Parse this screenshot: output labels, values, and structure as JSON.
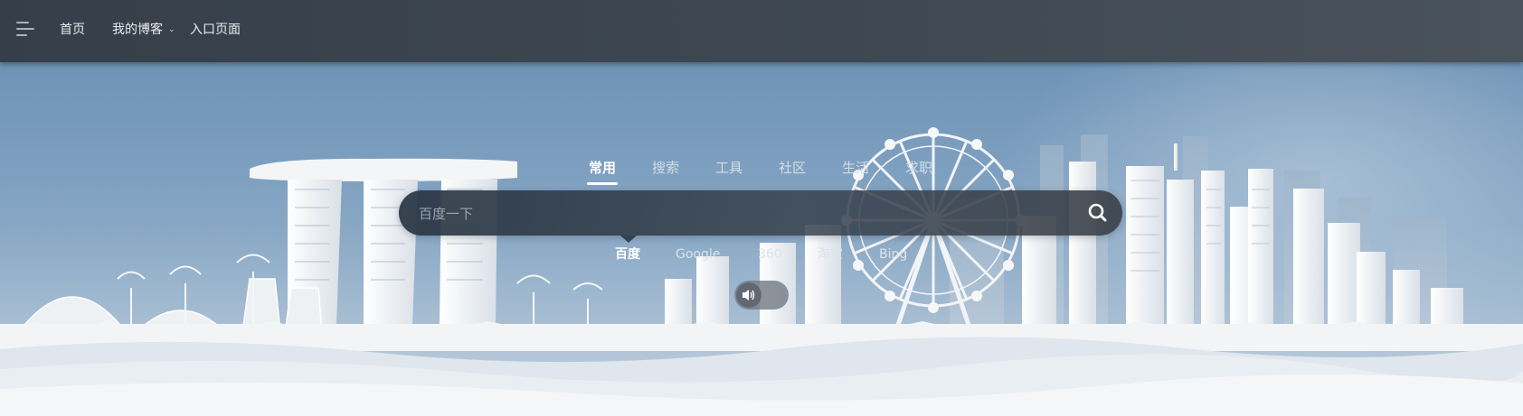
{
  "nav": {
    "menu_icon": "hamburger-menu-icon",
    "home": "首页",
    "blog": "我的博客",
    "blog_caret_icon": "chevron-down-icon",
    "entry": "入口页面"
  },
  "search": {
    "tabs": [
      {
        "label": "常用",
        "active": true
      },
      {
        "label": "搜索",
        "active": false
      },
      {
        "label": "工具",
        "active": false
      },
      {
        "label": "社区",
        "active": false
      },
      {
        "label": "生活",
        "active": false
      },
      {
        "label": "求职",
        "active": false
      }
    ],
    "placeholder": "百度一下",
    "button_icon": "search-icon",
    "engines": [
      {
        "label": "百度",
        "active": true
      },
      {
        "label": "Google",
        "active": false
      },
      {
        "label": "360",
        "active": false
      },
      {
        "label": "淘宝",
        "active": false
      },
      {
        "label": "Bing",
        "active": false
      }
    ]
  },
  "sound": {
    "icon": "speaker-icon",
    "enabled": false
  },
  "colors": {
    "topbar": "#3f4852",
    "sky_top": "#6d93b6",
    "sky_bottom": "#c8d5e1",
    "buildings": "#f4f6f8"
  }
}
